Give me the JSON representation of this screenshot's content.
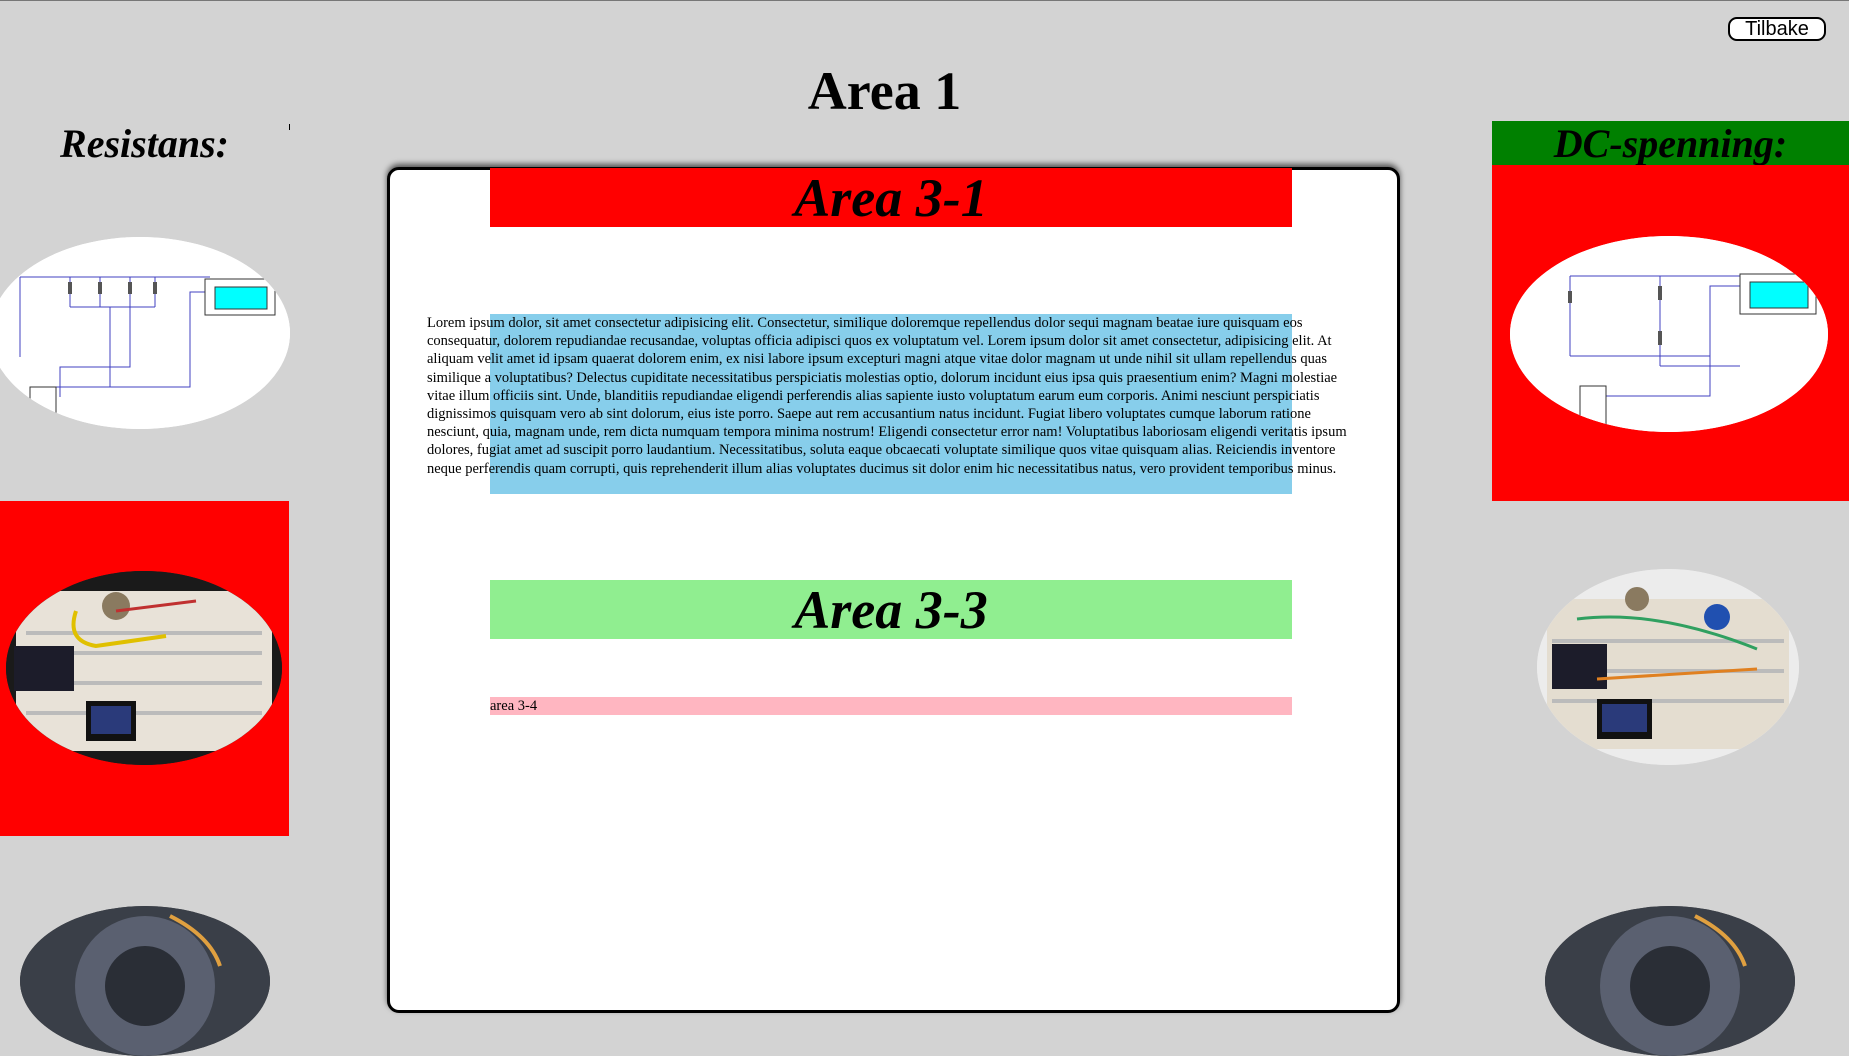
{
  "header": {
    "back_button": "Tilbake",
    "title": "Area 1"
  },
  "left": {
    "title": "Resistans:"
  },
  "right": {
    "title": "DC-spenning:"
  },
  "content": {
    "area31_title": "Area 3-1",
    "paragraph": "Lorem ipsum dolor, sit amet consectetur adipisicing elit. Consectetur, similique doloremque repellendus dolor sequi magnam beatae iure quisquam eos consequatur, dolorem repudiandae recusandae, voluptas officia adipisci quos ex voluptatum vel. Lorem ipsum dolor sit amet consectetur, adipisicing elit. At aliquam velit amet id ipsam quaerat dolorem enim, ex nisi labore ipsum excepturi magni atque vitae dolor magnam ut unde nihil sit ullam repellendus quas similique a voluptatibus? Delectus cupiditate necessitatibus perspiciatis molestias optio, dolorum incidunt eius ipsa quis praesentium enim? Magni molestiae vitae illum officiis sint. Unde, blanditiis repudiandae eligendi perferendis alias sapiente iusto voluptatum earum eum corporis. Animi nesciunt perspiciatis dignissimos quisquam vero ab sint dolorum, eius iste porro. Saepe aut rem accusantium natus incidunt. Fugiat libero voluptates cumque laborum ratione nesciunt, quia, magnam unde, rem dicta numquam tempora minima nostrum! Eligendi consectetur error nam! Voluptatibus laboriosam eligendi veritatis ipsum dolores, fugiat amet ad suscipit porro laudantium. Necessitatibus, soluta eaque obcaecati voluptate similique quos vitae quisquam alias. Reiciendis inventore neque perferendis quam corrupti, quis reprehenderit illum alias voluptates ducimus sit dolor enim hic necessitatibus natus, vero provident temporibus minus.",
    "area33_title": "Area 3-3",
    "area34_text": "area 3-4"
  },
  "colors": {
    "page_bg": "#d3d3d3",
    "red": "#ff0000",
    "green_title": "#008000",
    "light_green": "#90ee90",
    "sky_blue": "#87ceeb",
    "pink": "#ffb6c1"
  },
  "images": {
    "left_1": "resistance-circuit-diagram",
    "left_2": "breadboard-photo",
    "left_3": "speaker-photo",
    "right_1": "dc-voltage-circuit-diagram",
    "right_2": "breadboard-photo",
    "right_3": "speaker-photo"
  }
}
